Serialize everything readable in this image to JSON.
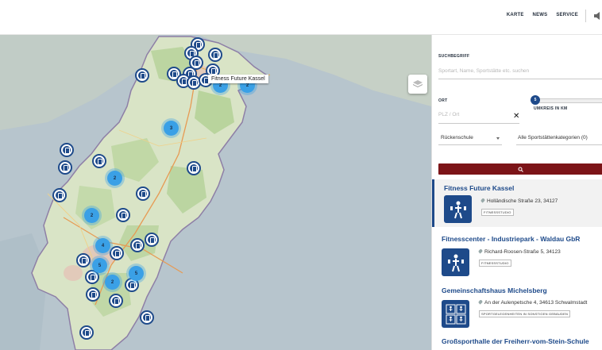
{
  "nav": {
    "items": [
      "KARTE",
      "NEWS",
      "SERVICE"
    ]
  },
  "map": {
    "tooltip": "Fitness Future Kassel",
    "clusters": [
      "2",
      "2",
      "3",
      "2",
      "2",
      "4",
      "5",
      "2",
      "5"
    ]
  },
  "search": {
    "term_label": "SUCHBEGRIFF",
    "term_placeholder": "Sportart, Name, Sportstätte etc. suchen",
    "place_label": "ORT",
    "place_placeholder": "PLZ / Ort",
    "radius_value": "5",
    "radius_label": "UMKREIS IN KM",
    "sport_select": "Rückenschule",
    "category_select": "Alle Sportstättenkategorien (0)"
  },
  "results": [
    {
      "title": "Fitness Future Kassel",
      "address": "Holländische Straße 23, 34127",
      "tag": "FITNESSSTUDIO",
      "icon": "fitness-icon"
    },
    {
      "title": "Fitnesscenter - Industriepark - Waldau GbR",
      "address": "Richard-Roosen-Straße 5, 34123",
      "tag": "FITNESSSTUDIO",
      "icon": "fitness-icon"
    },
    {
      "title": "Gemeinschaftshaus Michelsberg",
      "address": "An der Aulenpetsche 4, 34613 Schwalmstadt",
      "tag": "SPORTGELEGENHEITEN IN SONSTIGEN GEBÄUDEN",
      "icon": "multi-sport-icon"
    },
    {
      "title": "Großsporthalle der Freiherr-vom-Stein-Schule",
      "address": "",
      "tag": "",
      "icon": ""
    }
  ],
  "colors": {
    "accent": "#1e4a8a",
    "search_button": "#7c1418",
    "cluster": "#3aa0e6"
  }
}
